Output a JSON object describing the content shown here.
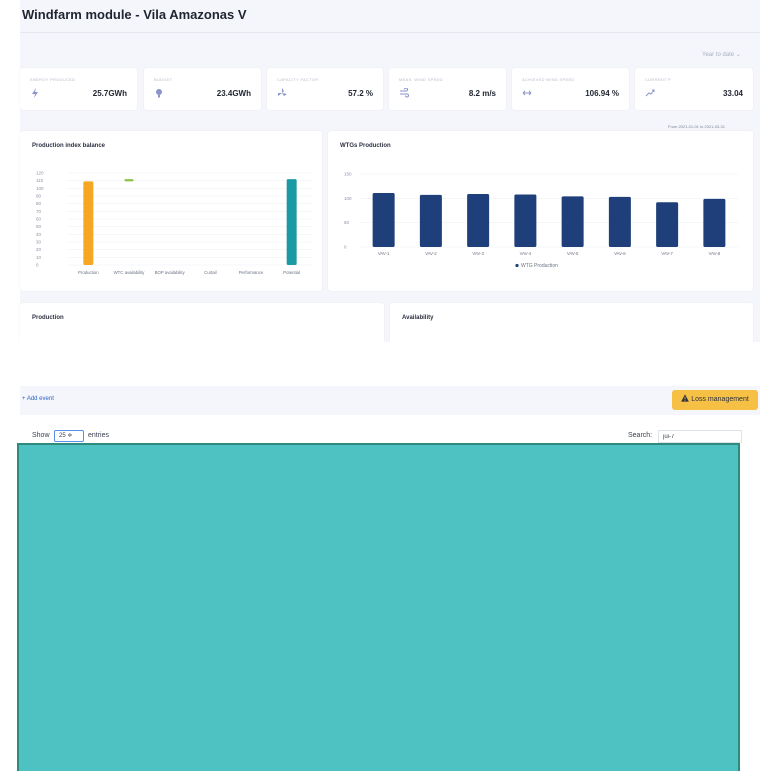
{
  "header": {
    "title": "Windfarm module - Vila Amazonas V",
    "period": "Year to date ⌄"
  },
  "kpis": [
    {
      "label": "ENERGY PRODUCED",
      "value": "25.7GWh",
      "icon": "lightning-icon"
    },
    {
      "label": "BUDGET",
      "value": "23.4GWh",
      "icon": "lightbulb-icon"
    },
    {
      "label": "CAPACITY FACTOR",
      "value": "57.2 %",
      "icon": "fan-icon"
    },
    {
      "label": "MEAS. WIND SPEED",
      "value": "8.2 m/s",
      "icon": "wind-icon"
    },
    {
      "label": "ACHIEVED WIND SPEED",
      "value": "106.94 %",
      "icon": "arrows-icon"
    },
    {
      "label": "CURRENT P",
      "value": "33.04",
      "icon": "trend-icon"
    }
  ],
  "date_range": "From 2021-01-01 to 2021-03-31",
  "cards": {
    "production_index": "Production index balance",
    "wtg_production": "WTGs Production",
    "production": "Production",
    "availability": "Availability"
  },
  "colors": {
    "accent_orange": "#f5a623",
    "accent_green": "#8bc34a",
    "accent_teal": "#1c9aa3",
    "bar_blue": "#1f3f7a",
    "overlay_teal": "#4ec1c3",
    "loss_yellow": "#f6c044"
  },
  "chart_data": [
    {
      "type": "bar",
      "title": "Production index balance",
      "categories": [
        "Production",
        "WTC availability",
        "BOP availability",
        "Curtail",
        "Performance",
        "Potential"
      ],
      "values": [
        109,
        3,
        0,
        0,
        0,
        112
      ],
      "base": [
        0,
        109,
        112,
        112,
        112,
        0
      ],
      "y_ticks": [
        "0",
        "10",
        "20",
        "30",
        "40",
        "50",
        "60",
        "70",
        "80",
        "90",
        "100",
        "110",
        "120"
      ],
      "ylim": [
        0,
        120
      ],
      "grid": true
    },
    {
      "type": "bar",
      "title": "WTGs Production",
      "categories": [
        "VAV-1",
        "VAV-2",
        "VAV-3",
        "VAV-4",
        "VAV-5",
        "VAV-6",
        "VAV-7",
        "VAV-8"
      ],
      "series": [
        {
          "name": "WTG Production",
          "values": [
            111,
            107,
            109,
            108,
            104,
            103,
            92,
            99
          ]
        }
      ],
      "y_ticks": [
        "0",
        "50",
        "100",
        "150"
      ],
      "ylim": [
        0,
        150
      ],
      "grid": true,
      "legend": "bottom"
    }
  ],
  "events": {
    "add_label": "+ Add event",
    "loss_button": "Loss management",
    "show_label": "Show",
    "entries_value": "25 ≑",
    "entries_label": "entries",
    "search_label": "Search:",
    "search_value": "jui-7"
  }
}
